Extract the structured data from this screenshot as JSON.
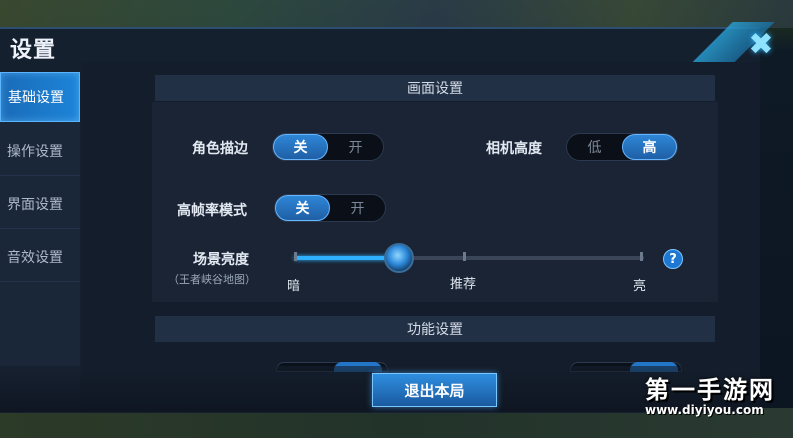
{
  "dialog": {
    "title": "设置",
    "close_icon": "close-x-icon"
  },
  "sidebar": {
    "items": [
      {
        "label": "基础设置",
        "active": true
      },
      {
        "label": "操作设置",
        "active": false
      },
      {
        "label": "界面设置",
        "active": false
      },
      {
        "label": "音效设置",
        "active": false
      }
    ]
  },
  "sections": {
    "display": {
      "title": "画面设置"
    },
    "function": {
      "title": "功能设置"
    }
  },
  "settings": {
    "outline": {
      "label": "角色描边",
      "options": [
        "关",
        "开"
      ],
      "selected": "关"
    },
    "camera_height": {
      "label": "相机高度",
      "options": [
        "低",
        "高"
      ],
      "selected": "高"
    },
    "high_fps": {
      "label": "高帧率模式",
      "options": [
        "关",
        "开"
      ],
      "selected": "关"
    },
    "brightness": {
      "label": "场景亮度",
      "sublabel": "（王者峡谷地图）",
      "min_label": "暗",
      "mid_label": "推荐",
      "max_label": "亮",
      "value": 0.3,
      "help_icon": "question-icon",
      "help_text": "?"
    }
  },
  "footer": {
    "exit_label": "退出本局"
  },
  "watermark": {
    "main": "第一手游网",
    "sub": "www.diyiyou.com"
  },
  "colors": {
    "accent": "#1f7fd6",
    "panel": "#141d2b",
    "active_tab": "#1d84d8"
  }
}
